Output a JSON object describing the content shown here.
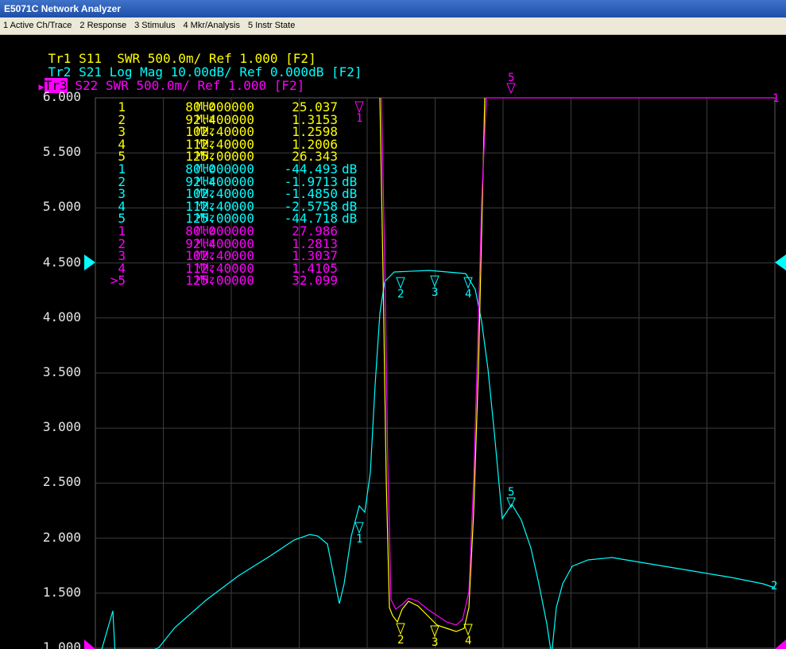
{
  "window": {
    "title": "E5071C Network Analyzer"
  },
  "menu": [
    "1 Active Ch/Trace",
    "2 Response",
    "3 Stimulus",
    "4 Mkr/Analysis",
    "5 Instr State"
  ],
  "traces": [
    {
      "name": "Tr1",
      "text": "S11  SWR 500.0m/ Ref 1.000 [F2]",
      "color": "#ffff00"
    },
    {
      "name": "Tr2",
      "text": "S21 Log Mag 10.00dB/ Ref 0.000dB [F2]",
      "color": "#00ffff"
    },
    {
      "name": "Tr3",
      "text": "S22 SWR 500.0m/ Ref 1.000 [F2]",
      "color": "#ff00ff"
    }
  ],
  "y_labels": [
    "6.000",
    "5.500",
    "5.000",
    "4.500",
    "4.000",
    "3.500",
    "3.000",
    "2.500",
    "2.000",
    "1.500",
    "1.000"
  ],
  "marker_table": [
    {
      "num": "1",
      "freq": "80.000000",
      "unit": "MHz",
      "value": "25.037",
      "db": "",
      "color": "#ffff00"
    },
    {
      "num": "2",
      "freq": "92.400000",
      "unit": "MHz",
      "value": "1.3153",
      "db": "",
      "color": "#ffff00"
    },
    {
      "num": "3",
      "freq": "102.40000",
      "unit": "MHz",
      "value": "1.2598",
      "db": "",
      "color": "#ffff00"
    },
    {
      "num": "4",
      "freq": "112.40000",
      "unit": "MHz",
      "value": "1.2006",
      "db": "",
      "color": "#ffff00"
    },
    {
      "num": "5",
      "freq": "125.00000",
      "unit": "MHz",
      "value": "26.343",
      "db": "",
      "color": "#ffff00"
    },
    {
      "num": "1",
      "freq": "80.000000",
      "unit": "MHz",
      "value": "-44.493",
      "db": "dB",
      "color": "#00ffff"
    },
    {
      "num": "2",
      "freq": "92.400000",
      "unit": "MHz",
      "value": "-1.9713",
      "db": "dB",
      "color": "#00ffff"
    },
    {
      "num": "3",
      "freq": "102.40000",
      "unit": "MHz",
      "value": "-1.4850",
      "db": "dB",
      "color": "#00ffff"
    },
    {
      "num": "4",
      "freq": "112.40000",
      "unit": "MHz",
      "value": "-2.5758",
      "db": "dB",
      "color": "#00ffff"
    },
    {
      "num": "5",
      "freq": "125.00000",
      "unit": "MHz",
      "value": "-44.718",
      "db": "dB",
      "color": "#00ffff"
    },
    {
      "num": "1",
      "freq": "80.000000",
      "unit": "MHz",
      "value": "27.986",
      "db": "",
      "color": "#ff00ff"
    },
    {
      "num": "2",
      "freq": "92.400000",
      "unit": "MHz",
      "value": "1.2813",
      "db": "",
      "color": "#ff00ff"
    },
    {
      "num": "3",
      "freq": "102.40000",
      "unit": "MHz",
      "value": "1.3037",
      "db": "",
      "color": "#ff00ff"
    },
    {
      "num": "4",
      "freq": "112.40000",
      "unit": "MHz",
      "value": "1.4105",
      "db": "",
      "color": "#ff00ff"
    },
    {
      "num": ">5",
      "freq": "125.00000",
      "unit": "MHz",
      "value": "32.099",
      "db": "",
      "color": "#ff00ff"
    }
  ],
  "chart_data": {
    "type": "line",
    "title": "",
    "xlabel": "",
    "ylabel": "",
    "ylim": [
      1.0,
      6.0
    ],
    "y_ticks": [
      6.0,
      5.5,
      5.0,
      4.5,
      4.0,
      3.5,
      3.0,
      2.5,
      2.0,
      1.5,
      1.0
    ],
    "grid": true,
    "series": [
      {
        "name": "Tr1",
        "color": "#ffff00",
        "x": [
          92.4,
          95,
          97,
          100,
          102.4,
          105,
          108,
          110,
          112.4
        ],
        "y": [
          1.3153,
          1.3,
          1.36,
          1.37,
          1.2598,
          1.25,
          1.16,
          1.13,
          1.2006
        ]
      },
      {
        "name": "Tr2",
        "color": "#00ffff",
        "x": [
          92.4,
          95,
          98,
          102.4,
          106,
          110,
          112.4
        ],
        "y": [
          -1.9713,
          -1.7,
          -1.6,
          -1.485,
          -1.6,
          -1.9,
          -2.5758
        ]
      },
      {
        "name": "Tr3",
        "color": "#ff00ff",
        "x": [
          92.4,
          95,
          97,
          100,
          102.4,
          105,
          108,
          110,
          112.4
        ],
        "y": [
          1.2813,
          1.33,
          1.36,
          1.37,
          1.3037,
          1.3,
          1.22,
          1.2,
          1.4105
        ]
      }
    ],
    "markers": [
      {
        "label": "1",
        "color": "#ff00ff"
      },
      {
        "label": "5",
        "color": "#ff00ff"
      },
      {
        "label": "1",
        "color": "#00ffff"
      },
      {
        "label": "2",
        "color": "#00ffff"
      },
      {
        "label": "3",
        "color": "#00ffff"
      },
      {
        "label": "4",
        "color": "#00ffff"
      },
      {
        "label": "5",
        "color": "#00ffff"
      },
      {
        "label": "2",
        "color": "#ffff00"
      },
      {
        "label": "3",
        "color": "#ffff00"
      },
      {
        "label": "4",
        "color": "#ffff00"
      }
    ],
    "edge_labels": [
      {
        "label": "1",
        "color": "#ff00ff"
      },
      {
        "label": "2",
        "color": "#00ffff"
      }
    ]
  }
}
